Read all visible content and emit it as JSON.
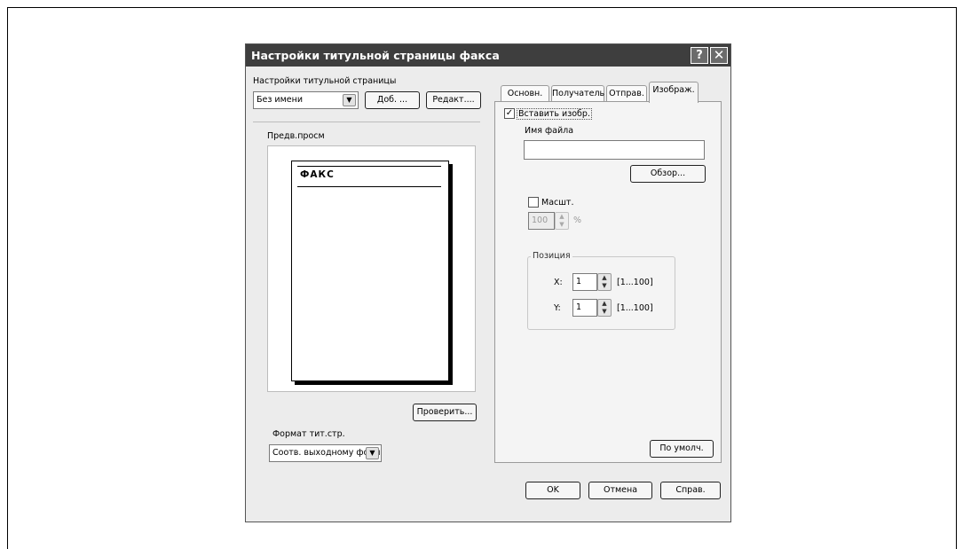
{
  "dialog": {
    "title": "Настройки титульной страницы факса",
    "help_button": "?",
    "close_button": "✕"
  },
  "left": {
    "cover_settings_label": "Настройки титульной страницы",
    "cover_settings_value": "Без имени",
    "add_button": "Доб. ...",
    "edit_button": "Редакт....",
    "preview_label": "Предв.просм",
    "preview_page_title": "ФАКС",
    "check_button": "Проверить...",
    "format_label": "Формат тит.стр.",
    "format_value": "Соотв. выходному форма"
  },
  "tabs": [
    {
      "label": "Основн."
    },
    {
      "label": "Получатель"
    },
    {
      "label": "Отправ."
    },
    {
      "label": "Изображ."
    }
  ],
  "active_tab": "Изображ.",
  "image_tab": {
    "insert_image_label": "Вставить изобр.",
    "insert_image_checked": true,
    "filename_label": "Имя файла",
    "filename_value": "",
    "browse_button": "Обзор...",
    "scale_label": "Масшт.",
    "scale_checked": false,
    "scale_value": "100",
    "scale_unit": "%",
    "position_group_label": "Позиция",
    "x_label": "X:",
    "x_value": "1",
    "x_range": "[1...100]",
    "y_label": "Y:",
    "y_value": "1",
    "y_range": "[1...100]",
    "default_button": "По умолч."
  },
  "footer": {
    "ok_button": "OK",
    "cancel_button": "Отмена",
    "help_button": "Справ."
  }
}
